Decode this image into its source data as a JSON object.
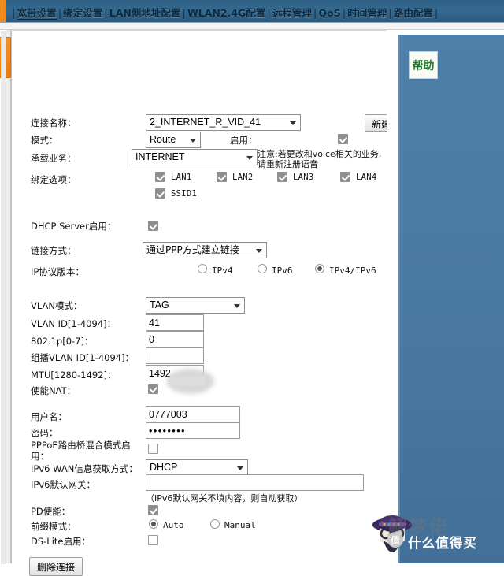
{
  "nav": {
    "items": [
      {
        "label": "宽带设置",
        "active": true
      },
      {
        "label": "绑定设置",
        "active": false
      },
      {
        "label": "LAN侧地址配置",
        "active": false
      },
      {
        "label": "WLAN2.4G配置",
        "active": false
      },
      {
        "label": "远程管理",
        "active": false
      },
      {
        "label": "QoS",
        "active": false
      },
      {
        "label": "时间管理",
        "active": false
      },
      {
        "label": "路由配置",
        "active": false
      }
    ],
    "separator": "|"
  },
  "help": {
    "button_label": "帮助",
    "panel_color": "#4a7ba5",
    "text_color": "#1e7a2e"
  },
  "form": {
    "connection_name": {
      "label": "连接名称：",
      "value": "2_INTERNET_R_VID_41"
    },
    "new_button": {
      "label": "新建"
    },
    "mode": {
      "label": "模式：",
      "value": "Route"
    },
    "enable": {
      "label": "启用：",
      "checked": true
    },
    "bearer_service": {
      "label": "承载业务：",
      "value": "INTERNET"
    },
    "voice_note": "注意:若更改和voice相关的业务, 请重新注册语音",
    "bind_options": {
      "label": "绑定选项：",
      "items": [
        {
          "label": "LAN1",
          "checked": true
        },
        {
          "label": "LAN2",
          "checked": true
        },
        {
          "label": "LAN3",
          "checked": true
        },
        {
          "label": "LAN4",
          "checked": true
        },
        {
          "label": "SSID1",
          "checked": true
        }
      ]
    },
    "dhcp_server": {
      "label": "DHCP Server启用：",
      "checked": true
    },
    "link_mode": {
      "label": "链接方式：",
      "value": "通过PPP方式建立链接"
    },
    "ip_version": {
      "label": "IP协议版本：",
      "options": [
        {
          "label": "IPv4",
          "selected": false
        },
        {
          "label": "IPv6",
          "selected": false
        },
        {
          "label": "IPv4/IPv6",
          "selected": true
        }
      ]
    },
    "vlan_mode": {
      "label": "VLAN模式：",
      "value": "TAG"
    },
    "vlan_id": {
      "label": "VLAN ID[1-4094]：",
      "value": "41"
    },
    "dot1p": {
      "label": "802.1p[0-7]：",
      "value": "0"
    },
    "multicast_vlan_id": {
      "label": "组播VLAN ID[1-4094]：",
      "value": ""
    },
    "mtu": {
      "label": "MTU[1280-1492]：",
      "value": "1492"
    },
    "enable_nat": {
      "label": "使能NAT：",
      "checked": true
    },
    "username": {
      "label": "用户名：",
      "value": "0777003"
    },
    "password": {
      "label": "密码：",
      "value": "••••••••"
    },
    "pppoe_bridge": {
      "label": "PPPoE路由桥混合模式启用：",
      "checked": false
    },
    "ipv6_wan_mode": {
      "label": "IPv6 WAN信息获取方式：",
      "value": "DHCP"
    },
    "ipv6_gateway": {
      "label": "IPv6默认网关：",
      "value": ""
    },
    "ipv6_gateway_hint": "（IPv6默认网关不填内容，则自动获取）",
    "pd_enable": {
      "label": "PD使能：",
      "checked": true
    },
    "prefix_mode": {
      "label": "前缀模式：",
      "options": [
        {
          "label": "Auto",
          "selected": true
        },
        {
          "label": "Manual",
          "selected": false
        }
      ]
    },
    "dslite": {
      "label": "DS-Lite启用：",
      "checked": false
    },
    "delete_button": {
      "label": "删除连接"
    }
  },
  "watermark": {
    "ghost_text": "解梦佬",
    "brand_text": "什么值得买",
    "badge_text": "值"
  }
}
